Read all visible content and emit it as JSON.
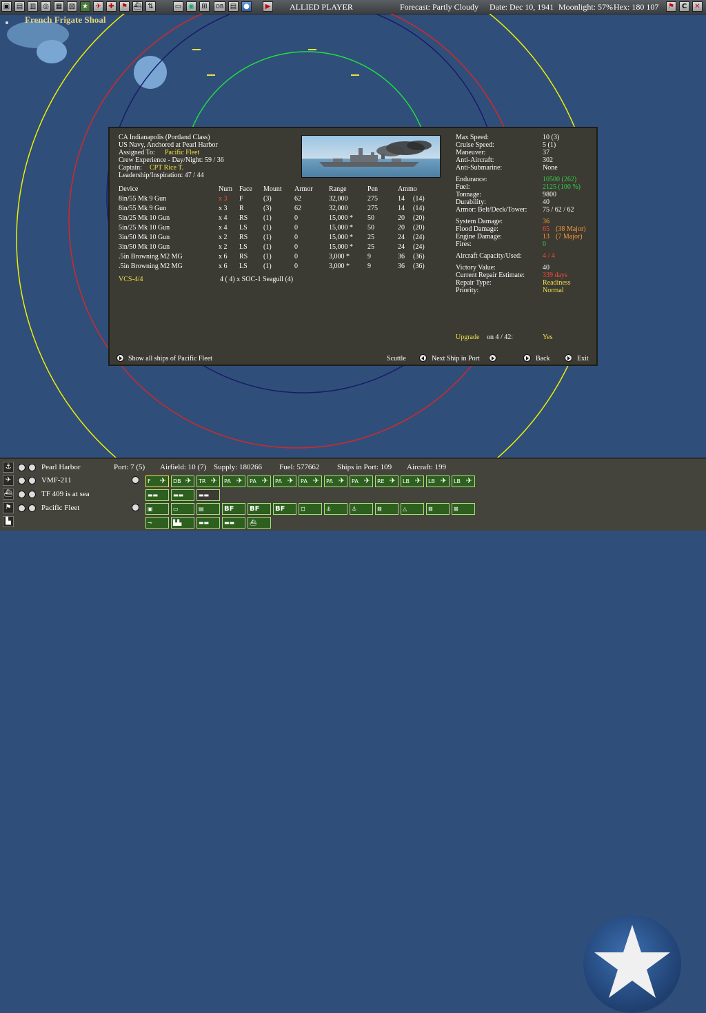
{
  "toolbar": {
    "player": "ALLIED PLAYER",
    "forecast": "Forecast: Partly Cloudy",
    "date": "Date: Dec 10, 1941",
    "moonlight": "Moonlight: 57%",
    "hex": "Hex: 180 107",
    "icons": [
      "save-icon",
      "options-icon",
      "memo-icon",
      "replay-icon",
      "combat-report-icon",
      "info-icon",
      "star-icon",
      "air-icon",
      "lcu-icon",
      "flag-icon",
      "ship-icon",
      "sort-icon",
      "base-icon",
      "globe-icon",
      "ob-icon",
      "list-icon",
      "screen-icon",
      "end-turn-icon"
    ],
    "right_icons": [
      "flag-icon",
      "c-icon",
      "close-icon"
    ],
    "ob_label": "OB",
    "c_label": "C"
  },
  "map": {
    "place_label": "French Frigate Shoal"
  },
  "ship": {
    "header": [
      "CA Indianapolis (Portland Class)",
      "US Navy, Anchored at Pearl Harbor"
    ],
    "assigned_label": "Assigned To:",
    "assigned_value": "Pacific Fleet",
    "crew": "Crew Experience - Day/Night: 59 / 36",
    "captain_label": "Captain:",
    "captain_value": "CPT Rice T.",
    "leadership": "Leadership/Inspiration: 47 / 44",
    "table_headers": [
      "Device",
      "Num",
      "Face",
      "Mount",
      "Armor",
      "Range",
      "Pen",
      "Ammo"
    ],
    "devices": [
      [
        "8in/55 Mk 9 Gun",
        "x 3",
        "F",
        "(3)",
        "62",
        "32,000",
        "275",
        "14",
        "(14)"
      ],
      [
        "8in/55 Mk 9 Gun",
        "x 3",
        "R",
        "(3)",
        "62",
        "32,000",
        "275",
        "14",
        "(14)"
      ],
      [
        "5in/25 Mk 10 Gun",
        "x 4",
        "RS",
        "(1)",
        "0",
        "15,000 *",
        "50",
        "20",
        "(20)"
      ],
      [
        "5in/25 Mk 10 Gun",
        "x 4",
        "LS",
        "(1)",
        "0",
        "15,000 *",
        "50",
        "20",
        "(20)"
      ],
      [
        "3in/50 Mk 10 Gun",
        "x 2",
        "RS",
        "(1)",
        "0",
        "15,000 *",
        "25",
        "24",
        "(24)"
      ],
      [
        "3in/50 Mk 10 Gun",
        "x 2",
        "LS",
        "(1)",
        "0",
        "15,000 *",
        "25",
        "24",
        "(24)"
      ],
      [
        ".5in Browning M2 MG",
        "x 6",
        "RS",
        "(1)",
        "0",
        "3,000 *",
        "9",
        "36",
        "(36)"
      ],
      [
        ".5in Browning M2 MG",
        "x 6",
        "LS",
        "(1)",
        "0",
        "3,000 *",
        "9",
        "36",
        "(36)"
      ]
    ],
    "air_group": "VCS-4/4",
    "air_detail": "4 ( 4) x SOC-1 Seagull (4)",
    "stats_labels": [
      "Max Speed:",
      "Cruise Speed:",
      "Maneuver:",
      "Anti-Aircraft:",
      "Anti-Submarine:"
    ],
    "stats_values": [
      "10 (3)",
      "5 (1)",
      "37",
      "302",
      "None"
    ],
    "stats2_labels": [
      "Endurance:",
      "Fuel:",
      "Tonnage:",
      "Durability:",
      "Armor: Belt/Deck/Tower:"
    ],
    "stats2_values": [
      "10500 (262)",
      "2125 (100 %)",
      "9800",
      "40",
      "75 / 62 / 62"
    ],
    "damage_labels": [
      "System Damage:",
      "Flood Damage:",
      "Engine Damage:",
      "Fires:"
    ],
    "system_damage": "36",
    "flood_damage": "65",
    "flood_major": "(38 Major)",
    "engine_damage": "13",
    "engine_major": "(7 Major)",
    "fires": "0",
    "aircraft_label": "Aircraft Capacity/Used:",
    "aircraft_value": "4 / 4",
    "victory_label": "Victory Value:",
    "victory_value": "40",
    "repair_est_label": "Current Repair Estimate:",
    "repair_est_value": "339 days",
    "repair_type_label": "Repair Type:",
    "repair_type_value": "Readiness",
    "priority_label": "Priority:",
    "priority_value": "Normal",
    "upgrade_label": "Upgrade",
    "upgrade_on": "on 4 / 42:",
    "upgrade_value": "Yes",
    "show_all": "Show all ships of Pacific Fleet",
    "scuttle": "Scuttle",
    "next_ship": "Next Ship in Port",
    "back": "Back",
    "exit": "Exit"
  },
  "bottom": {
    "base": "Pearl Harbor",
    "port": "Port: 7 (5)",
    "airfield": "Airfield: 10 (7)",
    "supply": "Supply: 180266",
    "fuel": "Fuel: 577662",
    "ships_in_port": "Ships in Port: 109",
    "aircraft": "Aircraft: 199",
    "squadron": "VMF-211",
    "tf": "TF 409 is at sea",
    "fleet": "Pacific Fleet",
    "plane_buttons": [
      "F",
      "DB",
      "TR",
      "PA",
      "PA",
      "PA",
      "PA",
      "PA",
      "PA",
      "RE",
      "LB",
      "LB",
      "LB"
    ],
    "mission_buttons": [
      "BF",
      "BF",
      "BF"
    ]
  },
  "colors": {
    "ocean": "#2f4f7a",
    "panel": "#3b3a33",
    "highlight_yellow": "#f2e14a",
    "ok_green": "#35d24a",
    "damage_red": "#ff4a3a",
    "damage_orange": "#ff9a3a"
  }
}
